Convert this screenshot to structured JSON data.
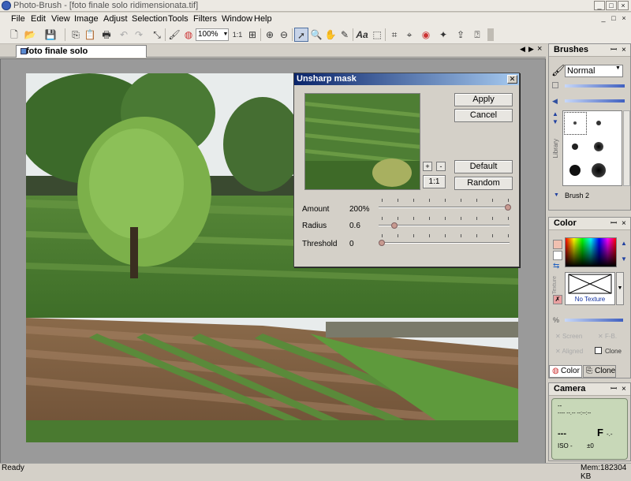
{
  "window": {
    "title": "Photo-Brush - [foto finale solo ridimensionata.tif]",
    "controls": [
      "_",
      "□",
      "×"
    ],
    "doc_controls": [
      "_",
      "□",
      "×"
    ]
  },
  "menu": [
    "File",
    "Edit",
    "View",
    "Image",
    "Adjust",
    "Selection",
    "Tools",
    "Filters",
    "Window",
    "Help"
  ],
  "toolbar": {
    "zoom_value": "100%",
    "one_to_one": "1:1"
  },
  "document": {
    "tab_label": "foto finale solo ridimensionata.tif"
  },
  "status": {
    "left": "Ready",
    "right": "Mem:182304 KB"
  },
  "dialog": {
    "title": "Unsharp mask",
    "apply": "Apply",
    "cancel": "Cancel",
    "default": "Default",
    "random": "Random",
    "zoom_in": "+",
    "zoom_out": "-",
    "one_to_one": "1:1",
    "params": [
      {
        "label": "Amount",
        "value": "200%",
        "level": 1.0
      },
      {
        "label": "Radius",
        "value": "0.6",
        "level": 0.1
      },
      {
        "label": "Threshold",
        "value": "0",
        "level": 0.0
      }
    ]
  },
  "brushes_panel": {
    "title": "Brushes",
    "mode": "Normal",
    "library_label": "Library",
    "brush_name": "Brush 2"
  },
  "color_panel": {
    "title": "Color",
    "texture_label": "Texture",
    "no_texture": "No Texture",
    "screen": "Screen",
    "fb": "F-B.",
    "aligned": "Aligned",
    "clone": "Clone",
    "tab_color": "Color",
    "tab_clone": "Clone"
  },
  "camera_panel": {
    "title": "Camera",
    "line1": "--",
    "line2": "---- --.-- --:--:--",
    "shutter": "---",
    "aperture": "F",
    "aperture_value": "-.-",
    "iso": "ISO -",
    "ev": "±0"
  },
  "colors": {
    "dialog_title_start": "#0a246a",
    "dialog_title_end": "#a6caf0",
    "camera_lcd": "#c8d8b8",
    "panel_bg": "#d4d0c8"
  }
}
